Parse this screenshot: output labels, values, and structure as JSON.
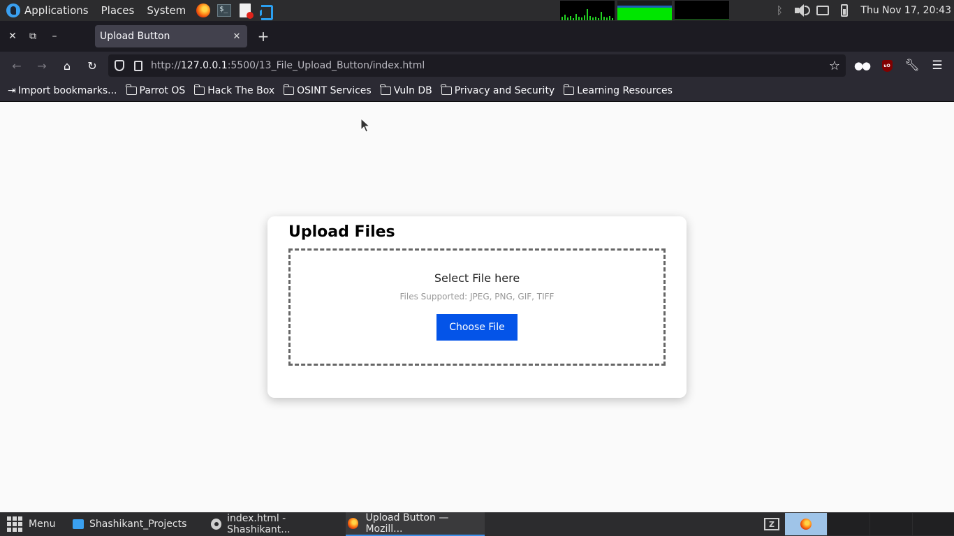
{
  "top_panel": {
    "menus": [
      "Applications",
      "Places",
      "System"
    ],
    "launchers": [
      "firefox-icon",
      "terminal-icon",
      "text-editor-icon",
      "vscode-icon"
    ],
    "terminal_glyph": "$_",
    "clock": "Thu Nov 17, 20:43"
  },
  "browser": {
    "tab_title": "Upload Button",
    "url_prefix": "http://",
    "url_host": "127.0.0.1",
    "url_rest": ":5500/13_File_Upload_Button/index.html",
    "bookmarks": [
      "Import bookmarks...",
      "Parrot OS",
      "Hack The Box",
      "OSINT Services",
      "Vuln DB",
      "Privacy and Security",
      "Learning Resources"
    ]
  },
  "page": {
    "title": "Upload Files",
    "drop_title": "Select File here",
    "drop_subtitle": "Files Supported: JPEG, PNG, GIF, TIFF",
    "button_label": "Choose File",
    "accent_color": "#0454e8"
  },
  "taskbar": {
    "menu_label": "Menu",
    "tasks": [
      "Shashikant_Projects",
      "index.html - Shashikant...",
      "Upload Button — Mozill..."
    ],
    "active_task": 2
  }
}
